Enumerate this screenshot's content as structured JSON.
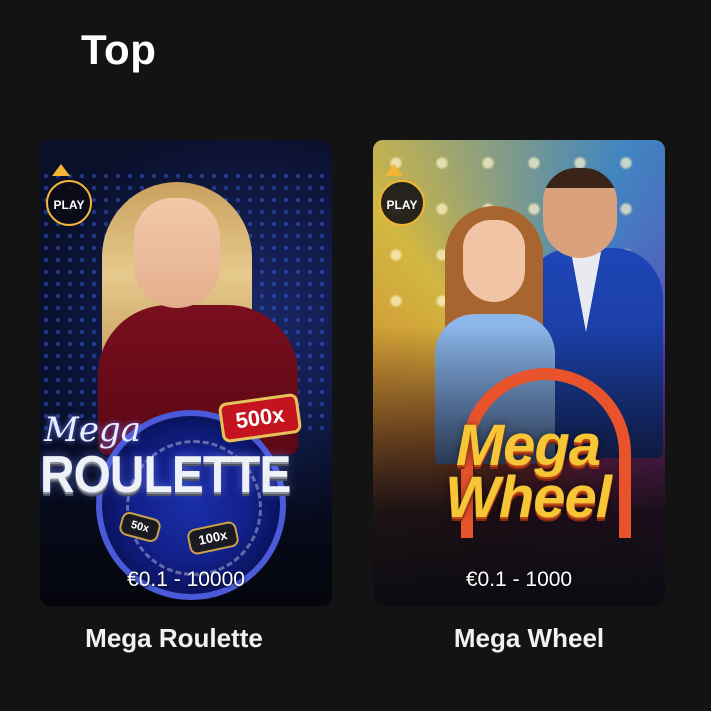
{
  "section": {
    "title": "Top"
  },
  "games": [
    {
      "name": "Mega Roulette",
      "limits": "€0.1 - 10000",
      "badge": "PLAY",
      "art": {
        "script_text": "Mega",
        "logo_text": "ROULETTE",
        "multipliers": [
          "500x",
          "50x",
          "100x"
        ]
      }
    },
    {
      "name": "Mega Wheel",
      "limits": "€0.1 - 1000",
      "badge": "PLAY",
      "art": {
        "logo_line1": "Mega",
        "logo_line2": "Wheel"
      }
    }
  ],
  "colors": {
    "background": "#131314",
    "badge_accent": "#f2b634",
    "roulette_red": "#c3141f",
    "wheel_gold": "#f6c637"
  }
}
